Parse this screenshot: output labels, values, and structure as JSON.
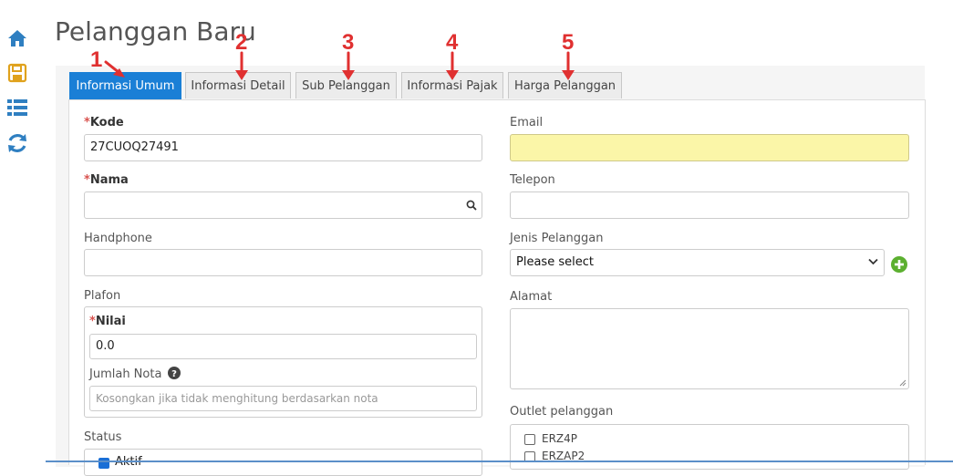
{
  "page": {
    "title": "Pelanggan Baru"
  },
  "sidebar": {
    "icons": [
      "home-icon",
      "save-icon",
      "list-icon",
      "refresh-icon"
    ]
  },
  "tabs": [
    {
      "label": "Informasi Umum",
      "active": true
    },
    {
      "label": "Informasi Detail",
      "active": false
    },
    {
      "label": "Sub Pelanggan",
      "active": false
    },
    {
      "label": "Informasi Pajak",
      "active": false
    },
    {
      "label": "Harga Pelanggan",
      "active": false
    }
  ],
  "annotations": [
    "1",
    "2",
    "3",
    "4",
    "5"
  ],
  "annotation_color": "#e03030",
  "accent_color": "#1a7fd6",
  "left": {
    "kode": {
      "label": "Kode",
      "value": "27CUOQ27491",
      "required": true
    },
    "nama": {
      "label": "Nama",
      "value": "",
      "required": true
    },
    "handphone": {
      "label": "Handphone",
      "value": ""
    },
    "plafon": {
      "label": "Plafon",
      "nilai": {
        "label": "Nilai",
        "value": "0.0",
        "required": true
      },
      "jumlah_nota": {
        "label": "Jumlah Nota",
        "placeholder": "Kosongkan jika tidak menghitung berdasarkan nota"
      }
    },
    "status": {
      "label": "Status",
      "option": "Aktif"
    }
  },
  "right": {
    "email": {
      "label": "Email",
      "value": ""
    },
    "telepon": {
      "label": "Telepon",
      "value": ""
    },
    "jenis_pelanggan": {
      "label": "Jenis Pelanggan",
      "selected": "Please select"
    },
    "alamat": {
      "label": "Alamat",
      "value": ""
    },
    "outlet": {
      "label": "Outlet pelanggan",
      "items": [
        "ERZ4P",
        "ERZAP2"
      ]
    }
  }
}
